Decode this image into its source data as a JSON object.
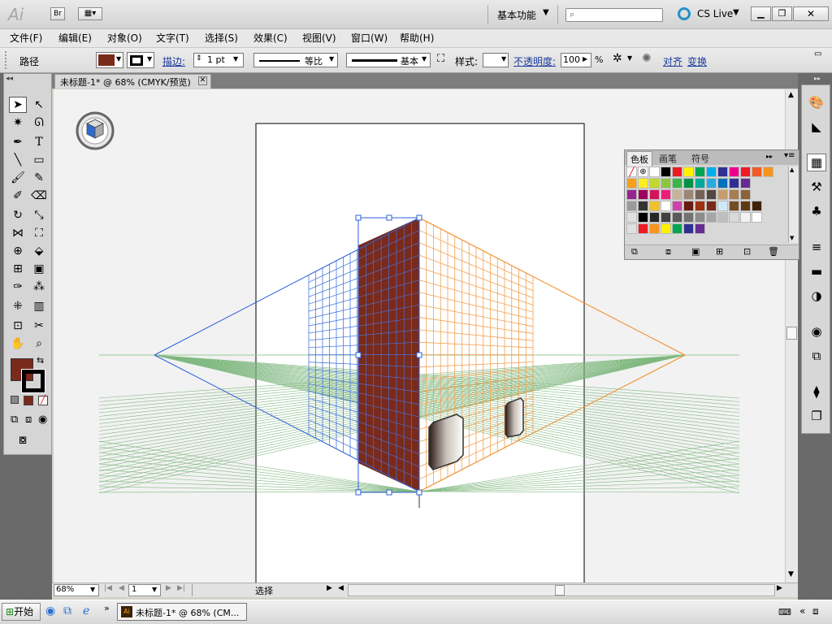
{
  "app": {
    "logo": "Ai",
    "bridge_label": "Br",
    "workspace": "基本功能",
    "search_placeholder": "",
    "cs_live": "CS Live"
  },
  "menu": [
    "文件(F)",
    "编辑(E)",
    "对象(O)",
    "文字(T)",
    "选择(S)",
    "效果(C)",
    "视图(V)",
    "窗口(W)",
    "帮助(H)"
  ],
  "control": {
    "path_label": "路径",
    "stroke_label": "描边:",
    "stroke_weight": "1 pt",
    "profile_label": "等比",
    "brush_label": "基本",
    "style_label": "样式:",
    "opacity_label": "不透明度:",
    "opacity_value": "100",
    "opacity_unit": "%",
    "align_label": "对齐",
    "transform_label": "变换"
  },
  "document": {
    "tab_title": "未标题-1* @ 68% (CMYK/预览)"
  },
  "status": {
    "zoom": "68%",
    "page": "1",
    "tool_status": "选择"
  },
  "swatch_panel": {
    "tabs": [
      "色板",
      "画笔",
      "符号"
    ],
    "rows": [
      [
        "#ffffff",
        "#000000",
        "#ec1c24",
        "#fff200",
        "#00a651",
        "#00aeef",
        "#2e3192",
        "#ec008c",
        "#ed1c24",
        "#f15a24",
        "#f7941d"
      ],
      [
        "#f9a01b",
        "#fcee21",
        "#c1d82f",
        "#8cc63f",
        "#39b54a",
        "#009245",
        "#00a99d",
        "#29abe2",
        "#0071bc",
        "#2e3192",
        "#662d91"
      ],
      [
        "#93278f",
        "#9e005d",
        "#d4145a",
        "#ed1e79",
        "#c7b299",
        "#998675",
        "#736357",
        "#534741",
        "#c69c6d",
        "#a67c52",
        "#8c6239"
      ],
      [
        "#754c24",
        "#603813",
        "#42210b"
      ],
      [
        "#000000",
        "#262626",
        "#404040",
        "#595959",
        "#737373",
        "#8c8c8c",
        "#a6a6a6",
        "#bfbfbf",
        "#d9d9d9",
        "#f2f2f2"
      ],
      [
        "#ed1c24",
        "#f7941d",
        "#fff200",
        "#00a651",
        "#2e3192",
        "#662d91"
      ]
    ]
  },
  "colors": {
    "fill": "#7a2a1a",
    "stroke": "#000000",
    "left_grid": "#2b5fd9",
    "right_grid": "#f08a24",
    "ground_grid": "#3a8a3a"
  },
  "taskbar": {
    "start": "开始",
    "window": "未标题-1* @ 68% (CM..."
  }
}
